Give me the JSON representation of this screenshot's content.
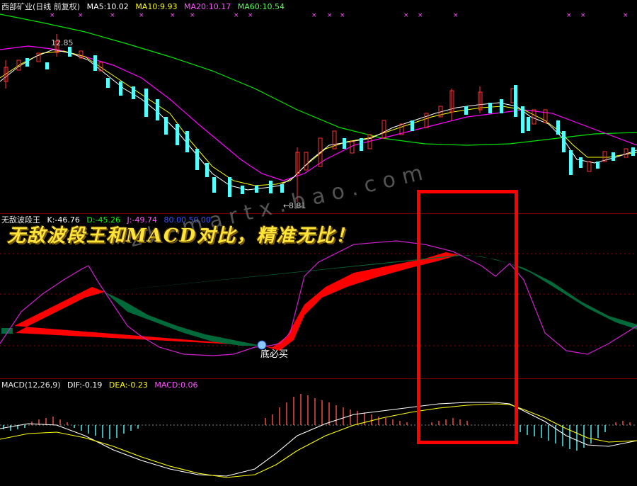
{
  "main_panel": {
    "title": "西部矿业(日线 前复权)",
    "ma5": "MA5:10.02",
    "ma10": "MA10:9.93",
    "ma20": "MA20:10.17",
    "ma60": "MA60:10.54",
    "high_label": "12.85",
    "low_label": "8.81"
  },
  "indicator_panel": {
    "title": "无敌波段王",
    "k": "K:-46.76",
    "d": "D:-45.26",
    "j": "J:-49.74",
    "extra": "80.00 50.00",
    "signal_label": "底必买",
    "banner": "无敌波段王和MACD对比，精准无比！",
    "watermark": "zb-martx.bao.com"
  },
  "macd_panel": {
    "title": "MACD(12,26,9)",
    "dif": "DIF:-0.19",
    "dea": "DEA:-0.23",
    "macd": "MACD:0.06"
  },
  "colors": {
    "up": "#ff3232",
    "down": "#54ffff",
    "ma5": "#ffffff",
    "ma10": "#ffff00",
    "ma20": "#ff00ff",
    "ma60": "#00e600",
    "band_up": "#ff0000",
    "band_down": "#006a3a",
    "highlight": "#ff0000"
  }
}
